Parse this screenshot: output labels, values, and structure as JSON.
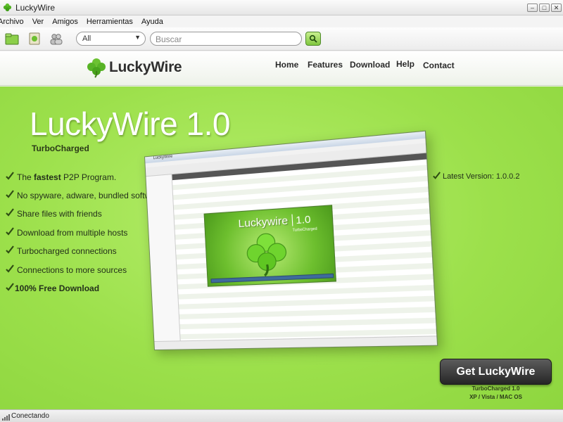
{
  "window": {
    "title": "LuckyWire"
  },
  "menu": [
    "Archivo",
    "Ver",
    "Amigos",
    "Herramientas",
    "Ayuda"
  ],
  "toolbar": {
    "icons": [
      "library-icon",
      "shared-files-icon",
      "friends-icon"
    ],
    "filter_value": "All",
    "search_placeholder": "Buscar"
  },
  "site": {
    "logo_text": "LuckyWire",
    "nav": [
      "Home",
      "Features",
      "Download",
      "Help",
      "Contact"
    ]
  },
  "hero": {
    "title": "LuckyWire 1.0",
    "subtitle": "TurboCharged",
    "features": [
      {
        "pre": "The ",
        "bold": "fastest",
        "post": " P2P Program."
      },
      {
        "pre": "No spyware, adware, bundled software",
        "bold": "",
        "post": ""
      },
      {
        "pre": "Share files with friends",
        "bold": "",
        "post": ""
      },
      {
        "pre": "Download from multiple hosts",
        "bold": "",
        "post": ""
      },
      {
        "pre": "Turbocharged connections",
        "bold": "",
        "post": ""
      },
      {
        "pre": "Connections to more sources",
        "bold": "",
        "post": ""
      },
      {
        "pre": "",
        "bold": "100% Free Download",
        "post": ""
      }
    ],
    "latest_version": "Latest Version: 1.0.0.2",
    "preview": {
      "window_title": "LuckyWire",
      "banner_title": "Luckywire",
      "banner_version": "1.0",
      "banner_sub": "TurboCharged"
    },
    "cta_label": "Get LuckyWire",
    "cta_sub1": "TurboCharged 1.0",
    "cta_sub2": "XP / Vista / MAC OS"
  },
  "status": {
    "text": "Conectando"
  },
  "colors": {
    "accent_green": "#9ce04b",
    "cta_dark": "#2e2e2e"
  }
}
